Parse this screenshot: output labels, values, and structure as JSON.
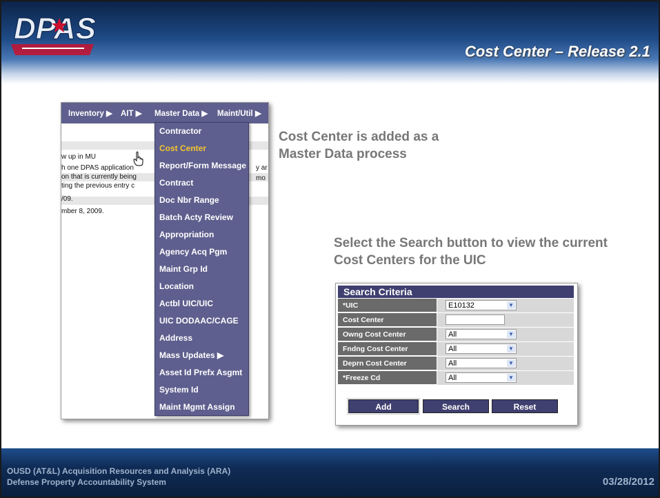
{
  "slide": {
    "logo_text": "DPAS",
    "title": "Cost Center – Release 2.1",
    "footer_line1": "OUSD (AT&L) Acquisition Resources and Analysis (ARA)",
    "footer_line2": "Defense Property Accountability System",
    "date": "03/28/2012",
    "colors": {
      "header_dark": "#0c2348",
      "menu_bg": "#5e5f8e",
      "active_item": "#f4c430",
      "form_header": "#3f3f70"
    }
  },
  "menu_screenshot": {
    "top_nav": [
      "Inventory ▶",
      "AIT ▶",
      "Master Data ▶",
      "Maint/Util ▶"
    ],
    "background_lines": [
      "w up in MU",
      "h one DPAS application",
      "on that is currently being",
      "ting the previous entry c",
      "/09.",
      "mber 8, 2009.",
      "y ar",
      "mo"
    ],
    "dropdown_items": [
      "Contractor",
      "Cost Center",
      "Report/Form Message",
      "Contract",
      "Doc Nbr Range",
      "Batch Acty Review",
      "Appropriation",
      "Agency Acq Pgm",
      "Maint Grp Id",
      "Location",
      "Actbl UIC/UIC",
      "UIC DODAAC/CAGE",
      "Address",
      "Mass Updates ▶",
      "Asset Id Prefx Asgmt",
      "System Id",
      "Maint Mgmt Assign"
    ],
    "active_item": "Cost Center",
    "cursor_icon": "hand-pointer-icon"
  },
  "captions": {
    "master_data": "Cost Center is added as a Master Data process",
    "search_hint": "Select the Search button to view the current Cost Centers for the UIC"
  },
  "search_form": {
    "header": "Search Criteria",
    "rows": [
      {
        "label": "*UIC",
        "type": "select",
        "value": "E10132"
      },
      {
        "label": "Cost Center",
        "type": "text",
        "value": ""
      },
      {
        "label": "Owng Cost Center",
        "type": "select",
        "value": "All"
      },
      {
        "label": "Fndng Cost Center",
        "type": "select",
        "value": "All"
      },
      {
        "label": "Deprn Cost Center",
        "type": "select",
        "value": "All"
      },
      {
        "label": "*Freeze Cd",
        "type": "select",
        "value": "All"
      }
    ],
    "buttons": {
      "add": "Add",
      "search": "Search",
      "reset": "Reset"
    }
  }
}
